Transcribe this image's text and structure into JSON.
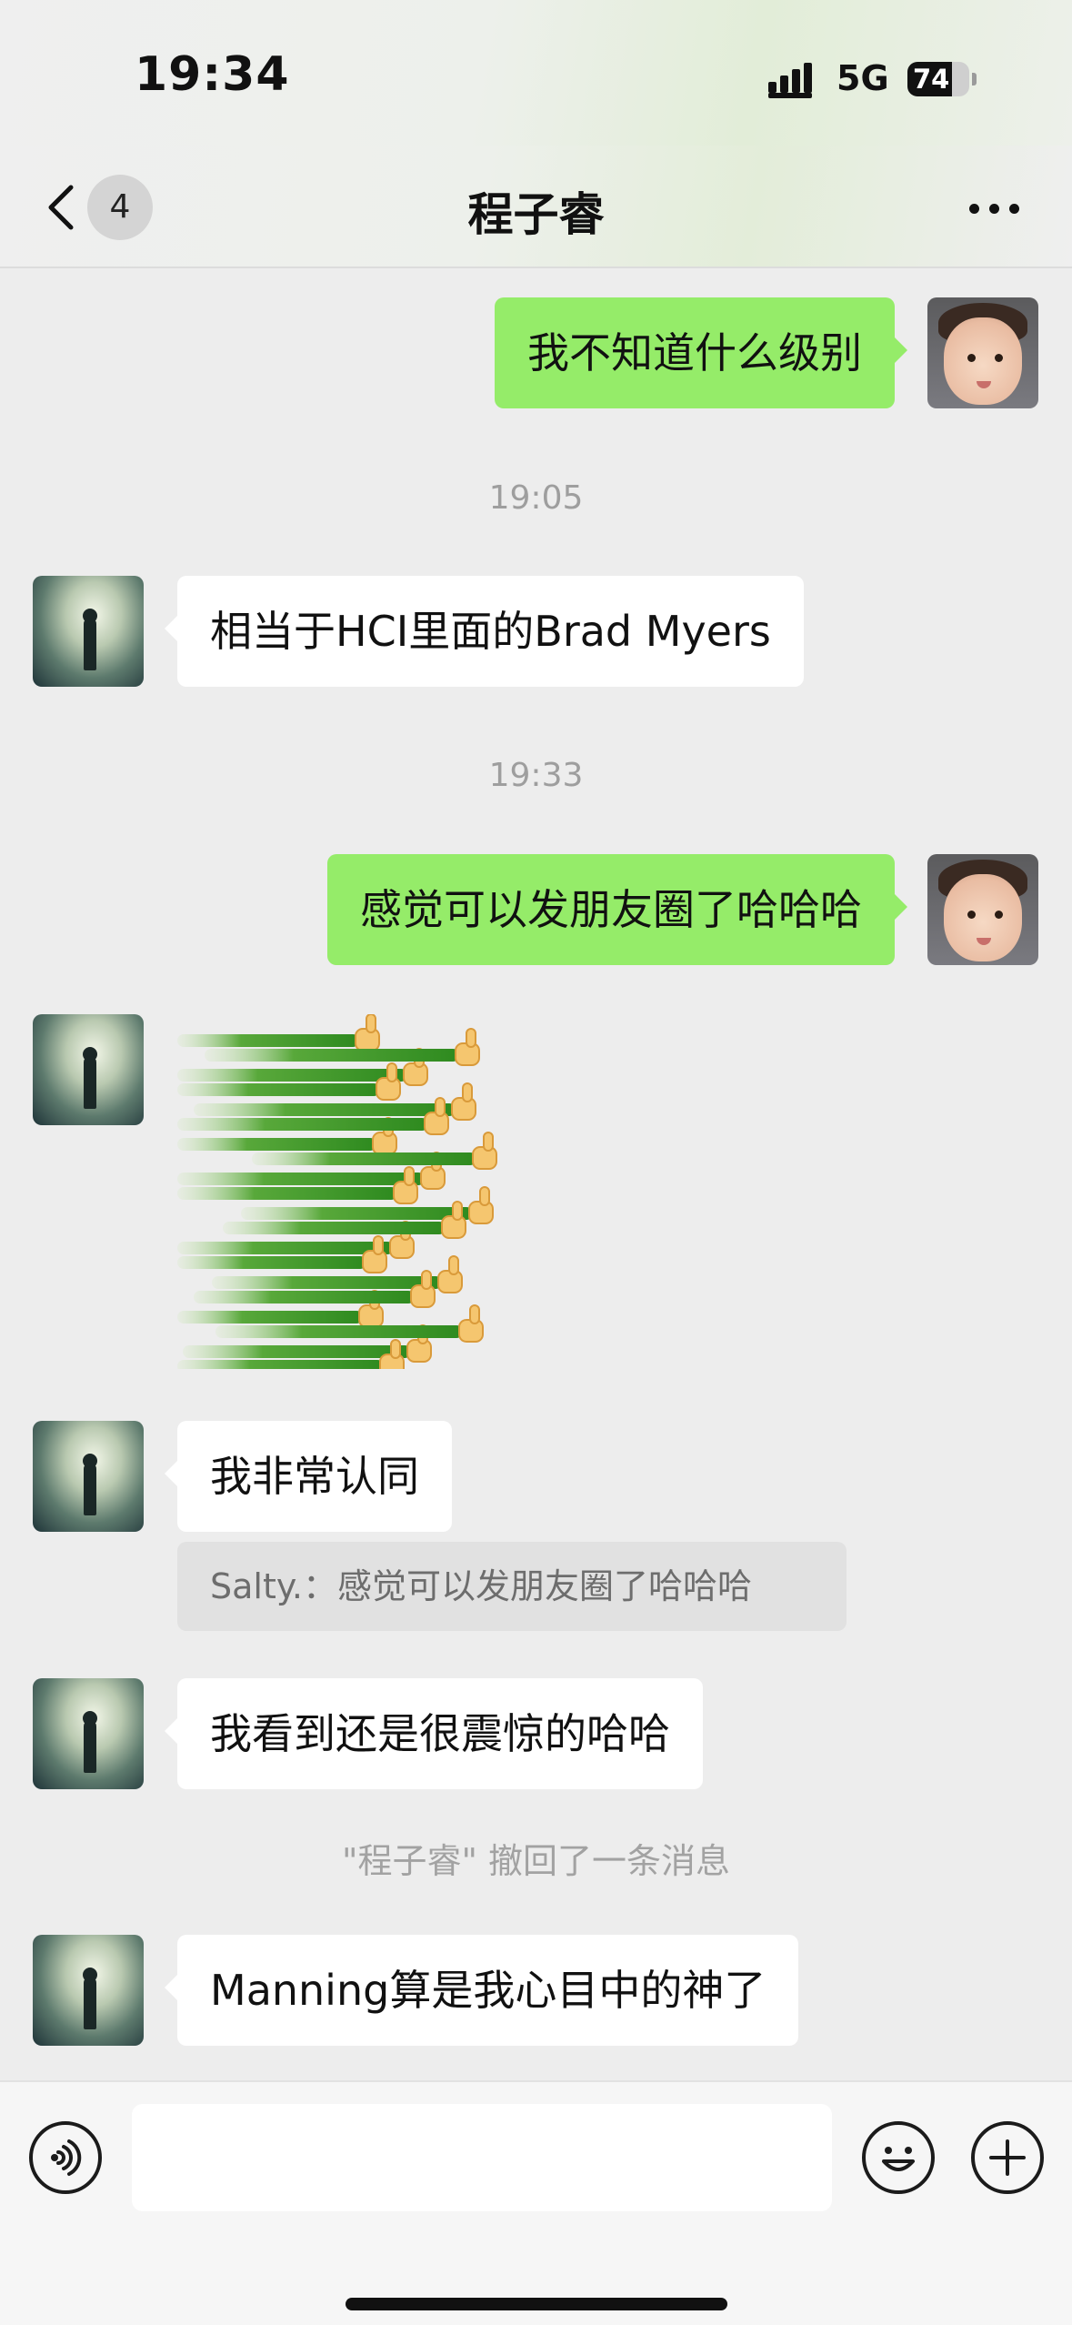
{
  "status_bar": {
    "time": "19:34",
    "network": "5G",
    "battery": "74"
  },
  "header": {
    "back_icon": "chevron-left-icon",
    "unread_count": "4",
    "title": "程子睿",
    "more_icon": "more-dots-icon"
  },
  "messages": [
    {
      "type": "text",
      "side": "out",
      "text": "我不知道什么级别"
    },
    {
      "type": "time",
      "text": "19:05"
    },
    {
      "type": "text",
      "side": "in",
      "text": "相当于HCI里面的Brad Myers"
    },
    {
      "type": "time",
      "text": "19:33"
    },
    {
      "type": "text",
      "side": "out",
      "text": "感觉可以发朋友圈了哈哈哈"
    },
    {
      "type": "sticker",
      "side": "in",
      "icon": "thumbs-up-sticker",
      "count": 20
    },
    {
      "type": "text",
      "side": "in",
      "text": "我非常认同"
    },
    {
      "type": "quote",
      "text": "Salty.：感觉可以发朋友圈了哈哈哈"
    },
    {
      "type": "text",
      "side": "in",
      "text": "我看到还是很震惊的哈哈"
    },
    {
      "type": "system",
      "text": "\"程子睿\" 撤回了一条消息"
    },
    {
      "type": "text",
      "side": "in",
      "text": "Manning算是我心目中的神了"
    }
  ],
  "input_bar": {
    "voice_icon": "voice-icon",
    "input_value": "",
    "emoji_icon": "emoji-icon",
    "plus_icon": "plus-icon"
  },
  "colors": {
    "outgoing_bubble": "#95ec69",
    "incoming_bubble": "#ffffff",
    "chat_background": "#ededed"
  }
}
